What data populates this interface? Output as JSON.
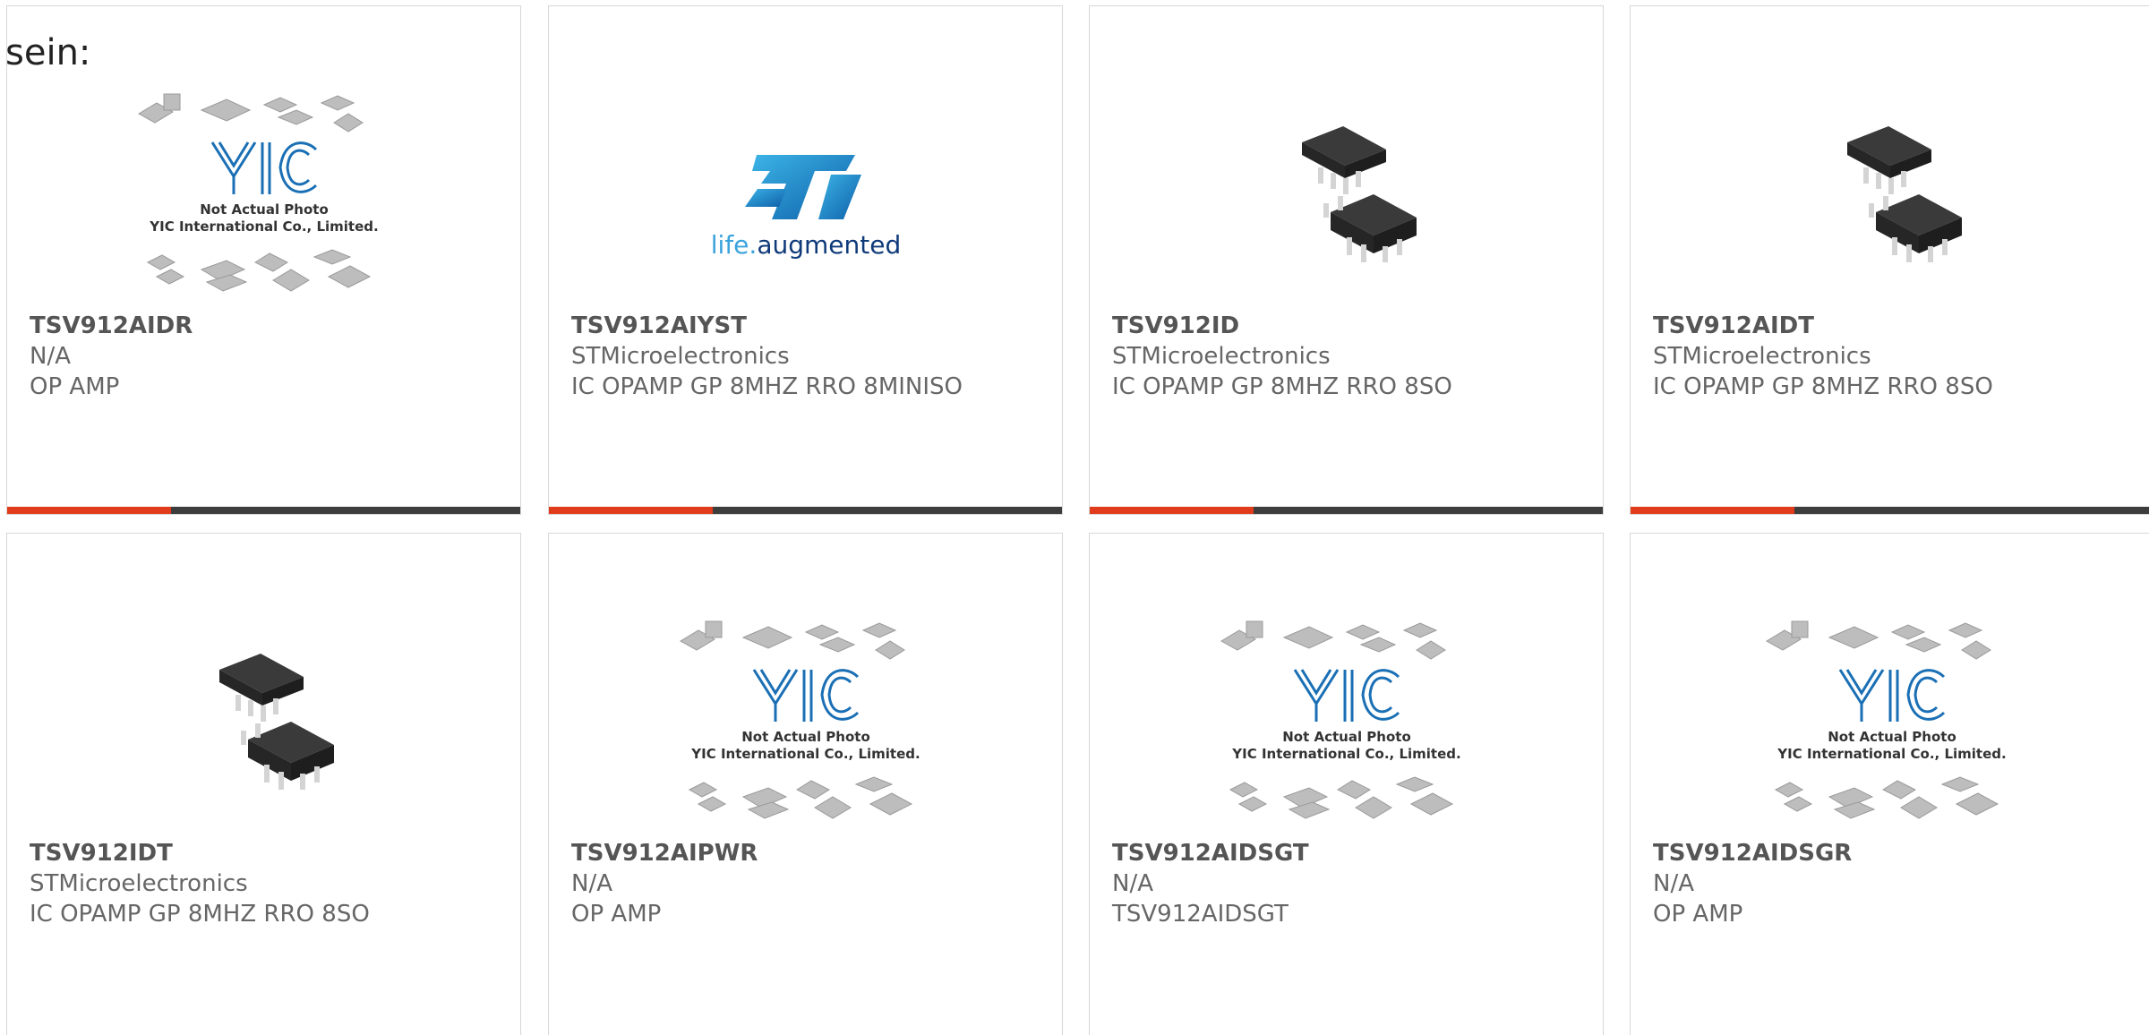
{
  "intro_text": "sein:",
  "colors": {
    "accent": "#e03c1c",
    "bar": "#3d3d3d",
    "st_logo": "#1a8fd1"
  },
  "placeholder_image": {
    "line1": "Not Actual Photo",
    "line2": "YIC International Co., Limited."
  },
  "st_logo": {
    "tagline_a": "life.",
    "tagline_b": "augmented"
  },
  "products": [
    {
      "part": "TSV912AIDR",
      "manufacturer": "N/A",
      "description": "OP AMP",
      "image": "placeholder"
    },
    {
      "part": "TSV912AIYST",
      "manufacturer": "STMicroelectronics",
      "description": "IC OPAMP GP 8MHZ RRO 8MINISO",
      "image": "st-logo"
    },
    {
      "part": "TSV912ID",
      "manufacturer": "STMicroelectronics",
      "description": "IC OPAMP GP 8MHZ RRO 8SO",
      "image": "soic-chip"
    },
    {
      "part": "TSV912AIDT",
      "manufacturer": "STMicroelectronics",
      "description": "IC OPAMP GP 8MHZ RRO 8SO",
      "image": "soic-chip"
    },
    {
      "part": "TSV912IDT",
      "manufacturer": "STMicroelectronics",
      "description": "IC OPAMP GP 8MHZ RRO 8SO",
      "image": "soic-chip"
    },
    {
      "part": "TSV912AIPWR",
      "manufacturer": "N/A",
      "description": "OP AMP",
      "image": "placeholder"
    },
    {
      "part": "TSV912AIDSGT",
      "manufacturer": "N/A",
      "description": "TSV912AIDSGT",
      "image": "placeholder"
    },
    {
      "part": "TSV912AIDSGR",
      "manufacturer": "N/A",
      "description": "OP AMP",
      "image": "placeholder"
    }
  ]
}
